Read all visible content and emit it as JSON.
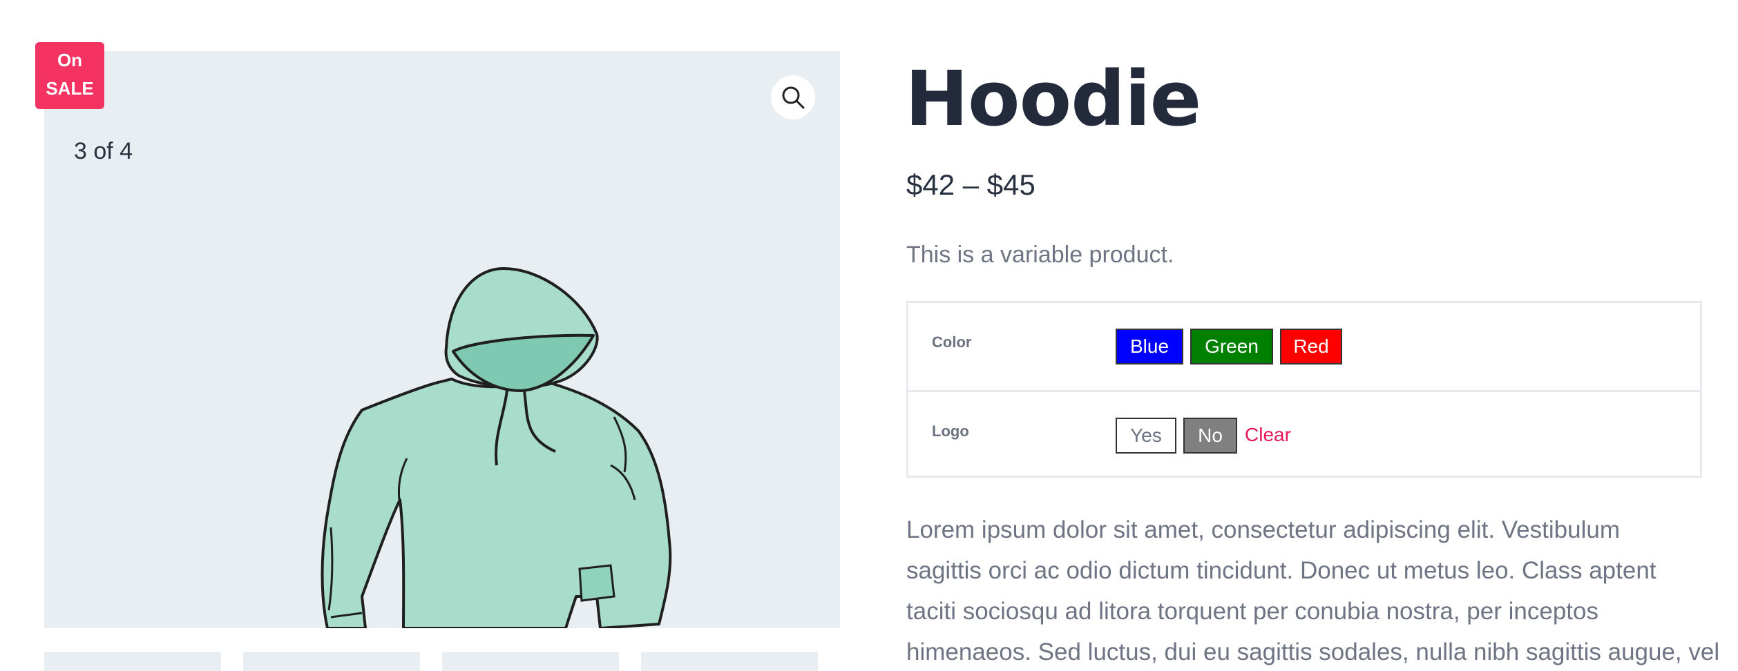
{
  "badge": {
    "line1": "On",
    "line2": "SALE"
  },
  "gallery": {
    "counter": "3 of 4",
    "zoom_icon": "magnifier-icon",
    "thumbnail_count": 4
  },
  "product": {
    "title": "Hoodie",
    "price": "$42 – $45",
    "short_description": "This is a variable product."
  },
  "variations": {
    "color": {
      "label": "Color",
      "options": [
        {
          "label": "Blue",
          "bg": "#0000ff",
          "fg": "#ffffff"
        },
        {
          "label": "Green",
          "bg": "#008000",
          "fg": "#ffffff"
        },
        {
          "label": "Red",
          "bg": "#ff0000",
          "fg": "#ffffff"
        }
      ]
    },
    "logo": {
      "label": "Logo",
      "options": [
        {
          "label": "Yes",
          "bg": "#ffffff",
          "fg": "#6e7483"
        },
        {
          "label": "No",
          "bg": "#808080",
          "fg": "#ffffff"
        }
      ],
      "clear_label": "Clear"
    }
  },
  "description": {
    "lines": [
      "Lorem ipsum dolor sit amet, consectetur adipiscing elit. Vestibulum",
      "sagittis orci ac odio dictum tincidunt. Donec ut metus leo. Class aptent",
      "taciti sociosqu ad litora torquent per conubia nostra, per inceptos",
      "himenaeos. Sed luctus, dui eu sagittis sodales, nulla nibh sagittis augue, vel"
    ]
  },
  "colors": {
    "accent": "#f43363",
    "link": "#e8135b",
    "heading": "#222a3b",
    "muted": "#6e7483",
    "gallery_bg": "#e8eef1"
  }
}
